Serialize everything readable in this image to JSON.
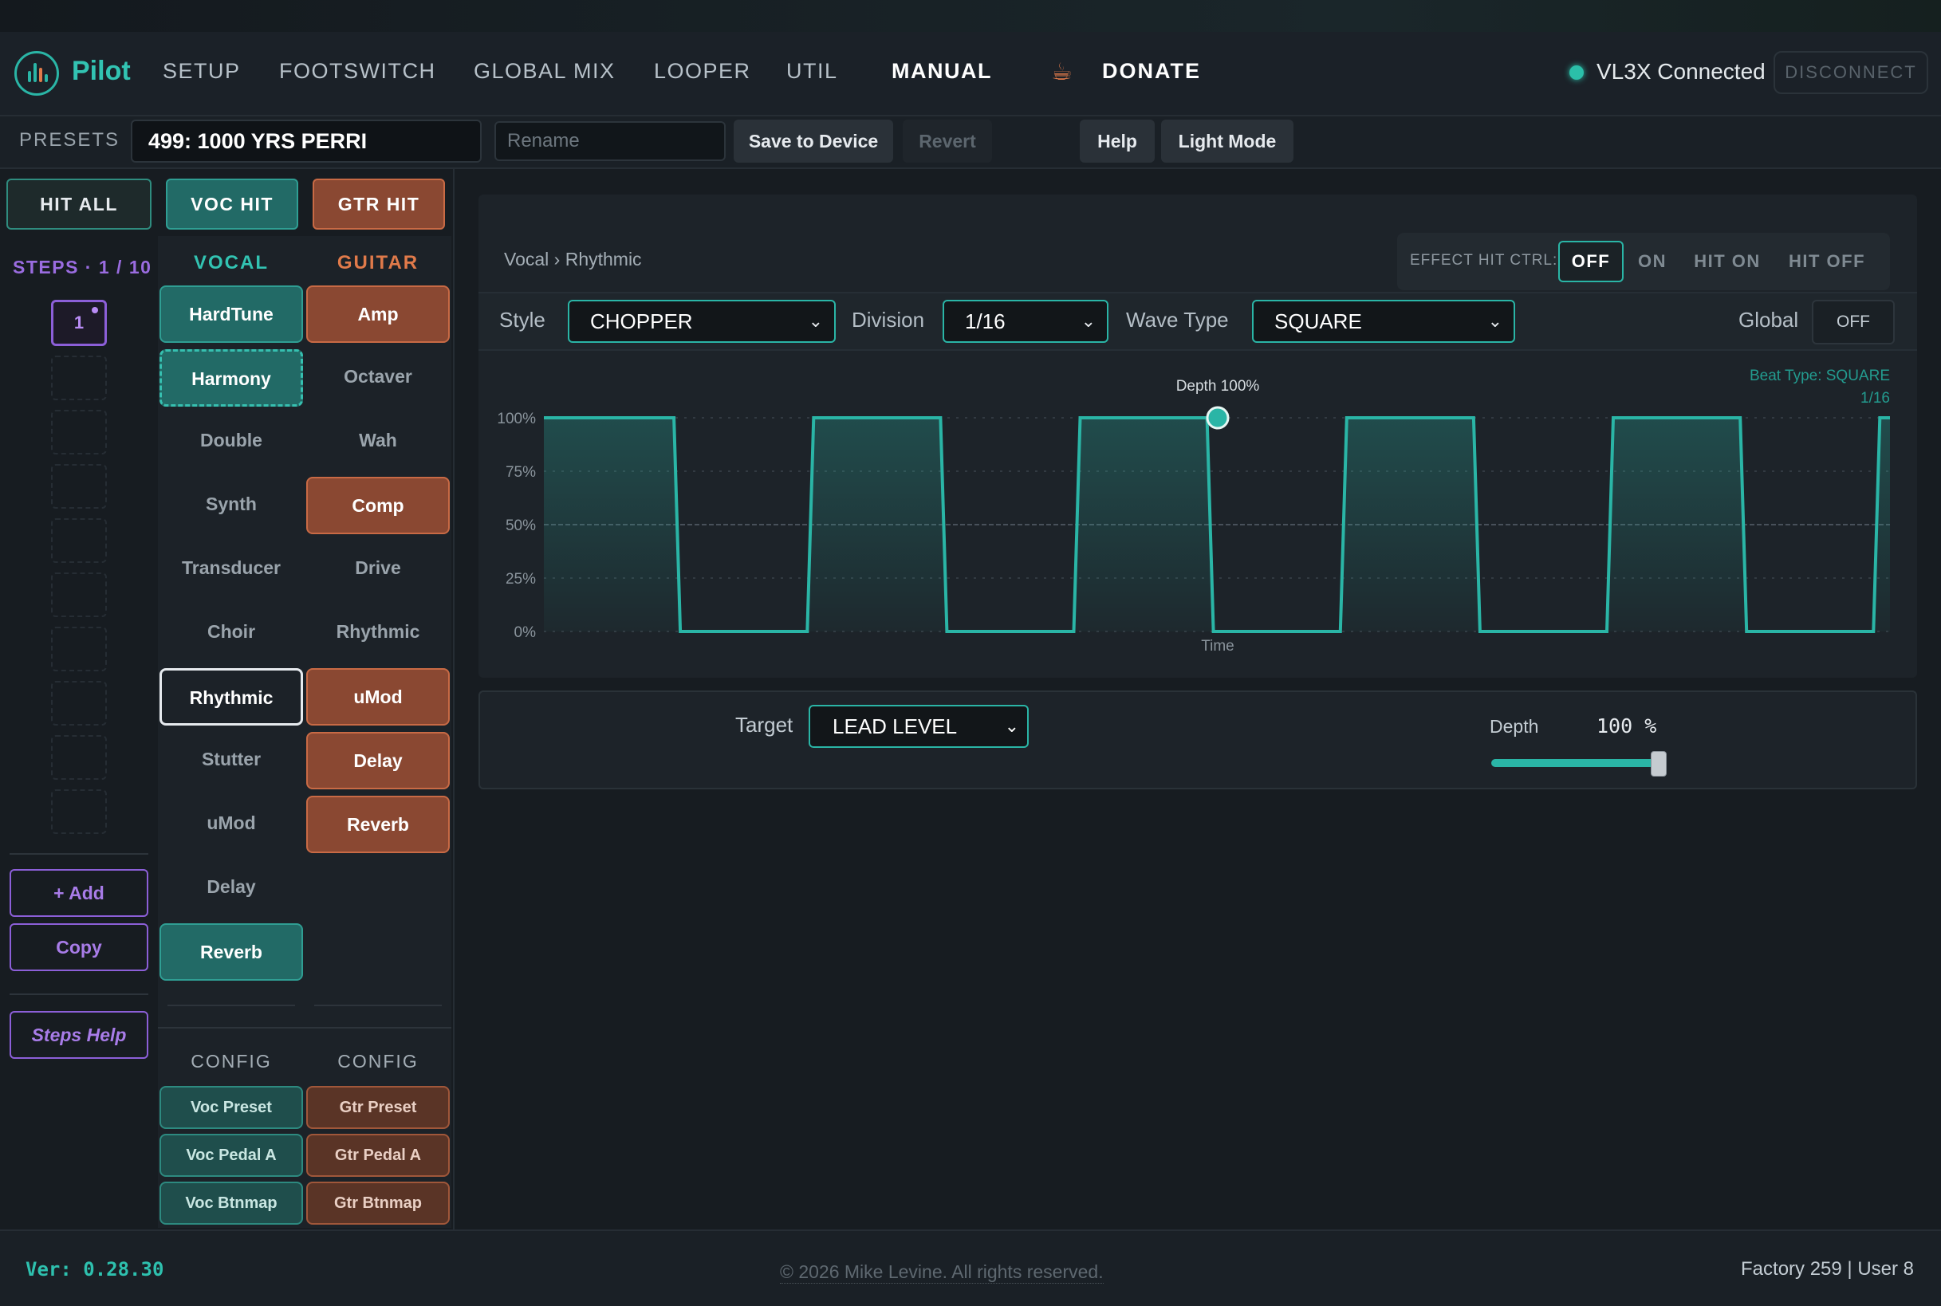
{
  "app": {
    "name": "Pilot"
  },
  "nav": {
    "items": [
      "SETUP",
      "FOOTSWITCH",
      "GLOBAL MIX",
      "LOOPER",
      "UTIL"
    ],
    "manual": "MANUAL",
    "donate": "DONATE",
    "status": "VL3X Connected",
    "disconnect": "DISCONNECT"
  },
  "presets": {
    "label": "PRESETS",
    "current": "499: 1000 YRS PERRI",
    "rename_placeholder": "Rename",
    "save": "Save to Device",
    "revert": "Revert",
    "help": "Help",
    "light_mode": "Light Mode"
  },
  "hits": {
    "all": "HIT ALL",
    "voc": "VOC HIT",
    "gtr": "GTR HIT"
  },
  "steps": {
    "label": "STEPS · 1 / 10",
    "active": "1",
    "add": "+ Add",
    "copy": "Copy",
    "help": "Steps Help"
  },
  "vocal": {
    "header": "VOCAL",
    "effects": [
      "HardTune",
      "Harmony",
      "Double",
      "Synth",
      "Transducer",
      "Choir",
      "Rhythmic",
      "Stutter",
      "uMod",
      "Delay",
      "Reverb"
    ],
    "config": "CONFIG",
    "config_buttons": [
      "Voc Preset",
      "Voc Pedal A",
      "Voc Btnmap"
    ]
  },
  "guitar": {
    "header": "GUITAR",
    "effects": [
      "Amp",
      "Octaver",
      "Wah",
      "Comp",
      "Drive",
      "Rhythmic",
      "uMod",
      "Delay",
      "Reverb"
    ],
    "config": "CONFIG",
    "config_buttons": [
      "Gtr Preset",
      "Gtr Pedal A",
      "Gtr Btnmap"
    ]
  },
  "editor": {
    "breadcrumb": "Vocal › Rhythmic",
    "hit_ctrl_label": "EFFECT HIT CTRL:",
    "hit_ctrl_options": [
      "OFF",
      "ON",
      "HIT ON",
      "HIT OFF"
    ],
    "style_label": "Style",
    "style_value": "CHOPPER",
    "division_label": "Division",
    "division_value": "1/16",
    "wave_label": "Wave Type",
    "wave_value": "SQUARE",
    "global_label": "Global",
    "global_value": "OFF",
    "target_label": "Target",
    "target_value": "LEAD LEVEL",
    "depth_label": "Depth",
    "depth_value": "100",
    "depth_unit": "%",
    "depth_fraction": 1.0
  },
  "chart_data": {
    "type": "line",
    "title": "",
    "xlabel": "Time",
    "ylabel": "",
    "yticks": [
      "100%",
      "75%",
      "50%",
      "25%",
      "0%"
    ],
    "ylim": [
      0,
      100
    ],
    "marker_label": "Depth 100%",
    "beat_type": "Beat Type: SQUARE",
    "beat_division": "1/16",
    "waveform": "square",
    "cycles": 5,
    "series": [
      {
        "values_high": 100,
        "values_low": 0
      }
    ]
  },
  "colors": {
    "accent_teal": "#2ab5a6",
    "guitar_orange": "#c86a45",
    "steps_purple": "#8c5fd8"
  },
  "footer": {
    "version": "Ver: 0.28.30",
    "copyright": "© 2026 Mike Levine. All rights reserved.",
    "counts": "Factory 259 | User 8"
  }
}
